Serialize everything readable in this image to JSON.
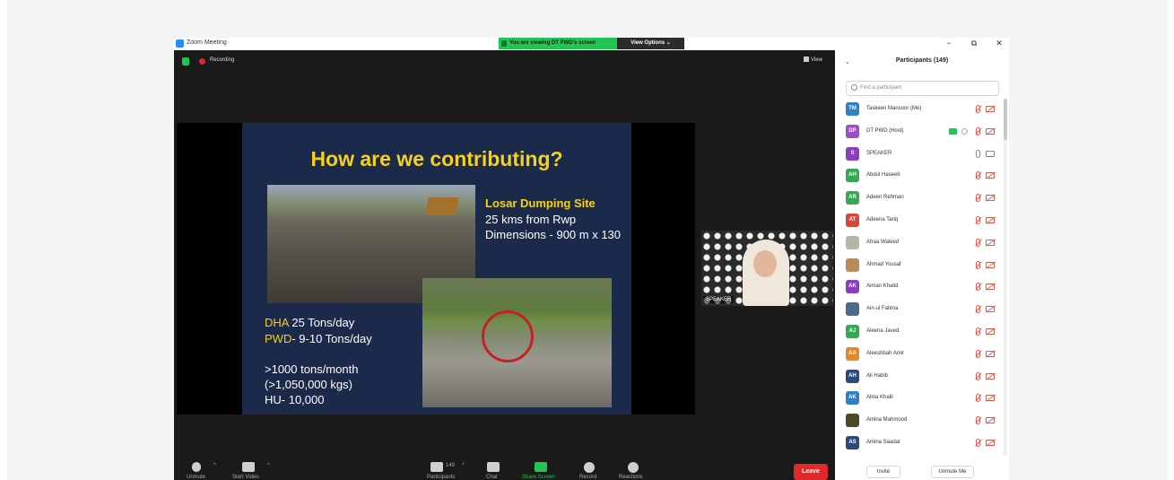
{
  "window": {
    "app_title": "Zoom Meeting",
    "viewing_banner": "You are viewing DT PWD's screen",
    "view_options": "View Options",
    "recording_label": "Recording",
    "view_label": "View",
    "win_minimize": "−",
    "win_restore": "⧉",
    "win_close": "✕"
  },
  "slide": {
    "title": "How are we contributing?",
    "site_heading": "Losar Dumping Site",
    "site_distance": "25 kms from Rwp",
    "site_dimensions": "Dimensions - 900 m x 130",
    "dha_label": "DHA",
    "dha_value": " 25 Tons/day",
    "pwd_label": "PWD",
    "pwd_value": "- 9-10 Tons/day",
    "monthly": ">1000 tons/month",
    "monthly_kg": "(>1,050,000 kgs)",
    "hu": "HU- 10,000"
  },
  "speaker_tile": {
    "name": "SPEAKER"
  },
  "toolbar": {
    "unmute": "Unmute",
    "start_video": "Start Video",
    "participants": "Participants",
    "participants_count": "149",
    "chat": "Chat",
    "share_screen": "Share Screen",
    "record": "Record",
    "reactions": "Reactions",
    "leave": "Leave"
  },
  "panel": {
    "collapse_icon": "chevron-down",
    "header": "Participants (149)",
    "search_placeholder": "Find a participant",
    "invite": "Invite",
    "unmute_me": "Unmute Me"
  },
  "participants": [
    {
      "initials": "TM",
      "name": "Taskeen Mansoor (Me)",
      "color": "#2f7fc1",
      "mic": "off",
      "cam": "off"
    },
    {
      "initials": "DP",
      "name": "DT PWD (Host)",
      "color": "#9b4fc2",
      "mic": "off",
      "cam": "off",
      "sharing": true
    },
    {
      "initials": "S",
      "name": "SPEAKER",
      "color": "#8a3fbf",
      "mic": "on",
      "cam": "on"
    },
    {
      "initials": "AH",
      "name": "Abdul Haseeb",
      "color": "#3aa757",
      "mic": "off",
      "cam": "off"
    },
    {
      "initials": "AR",
      "name": "Adeen Rehman",
      "color": "#3aa757",
      "mic": "off",
      "cam": "off"
    },
    {
      "initials": "AT",
      "name": "Adeena Tariq",
      "color": "#d44a3a",
      "mic": "off",
      "cam": "off"
    },
    {
      "initials": "",
      "name": "Afraa Waleed",
      "color": "#b7b7a8",
      "mic": "off",
      "cam": "off"
    },
    {
      "initials": "",
      "name": "Ahmad Yousaf",
      "color": "#b98a5c",
      "mic": "off",
      "cam": "off"
    },
    {
      "initials": "AK",
      "name": "Aiman Khalid",
      "color": "#8a3fbf",
      "mic": "off",
      "cam": "off"
    },
    {
      "initials": "",
      "name": "Ain-ul Fatima",
      "color": "#4d6a8c",
      "mic": "off",
      "cam": "off"
    },
    {
      "initials": "AJ",
      "name": "Aleena Javed",
      "color": "#3aa757",
      "mic": "off",
      "cam": "off"
    },
    {
      "initials": "AA",
      "name": "Aleeshbah Amir",
      "color": "#e08a2a",
      "mic": "off",
      "cam": "off"
    },
    {
      "initials": "AH",
      "name": "Ali Habib",
      "color": "#2f4a7a",
      "mic": "off",
      "cam": "off"
    },
    {
      "initials": "AK",
      "name": "Alina Khalil",
      "color": "#2f7fc1",
      "mic": "off",
      "cam": "off"
    },
    {
      "initials": "",
      "name": "Amina Mahmood",
      "color": "#4a4a2a",
      "mic": "off",
      "cam": "off"
    },
    {
      "initials": "AS",
      "name": "Amina Saadat",
      "color": "#2f4a7a",
      "mic": "off",
      "cam": "off"
    }
  ]
}
